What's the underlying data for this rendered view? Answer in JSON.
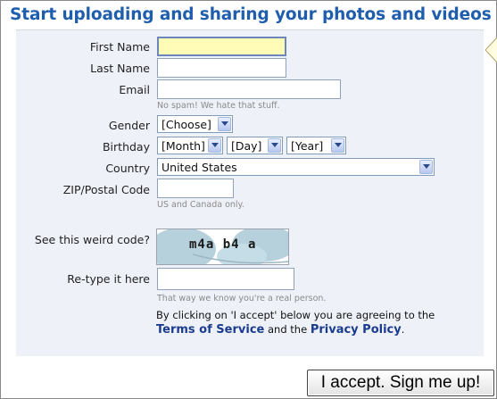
{
  "heading": "Start uploading and sharing your photos and videos",
  "form": {
    "first_name": {
      "label": "First Name",
      "value": ""
    },
    "last_name": {
      "label": "Last Name",
      "value": ""
    },
    "email": {
      "label": "Email",
      "value": "",
      "hint": "No spam! We hate that stuff."
    },
    "gender": {
      "label": "Gender",
      "selected": "[Choose]"
    },
    "birthday": {
      "label": "Birthday",
      "month": "[Month]",
      "day": "[Day]",
      "year": "[Year]"
    },
    "country": {
      "label": "Country",
      "selected": "United States"
    },
    "zip": {
      "label": "ZIP/Postal Code",
      "value": "",
      "hint": "US and Canada only."
    },
    "captcha": {
      "label": "See this weird code?",
      "code_display": "m4a b4 a"
    },
    "retype": {
      "label": "Re-type it here",
      "value": "",
      "hint": "That way we know you're a real person."
    }
  },
  "agreement": {
    "text": "By clicking on 'I accept' below you are agreeing to the",
    "tos_link": "Terms of Service",
    "and_text": "and the",
    "privacy_link": "Privacy Policy",
    "period": "."
  },
  "submit_label": "I accept. Sign me up!",
  "colors": {
    "heading": "#1f5dad",
    "panel_bg": "#eef1f7",
    "focused_input_bg": "#fffcb8",
    "link": "#1a3c8e"
  },
  "icons": {
    "dropdown": "chevron-down-icon",
    "panel_pointer": "arrow-left-icon"
  }
}
